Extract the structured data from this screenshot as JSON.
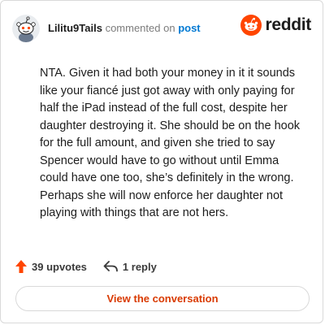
{
  "comment": {
    "username": "Lilitu9Tails",
    "action_text": "commented on",
    "target_link": "post",
    "body": "NTA. Given it had both your money in it it sounds like your fiancé just got away with only paying for half the iPad instead of the full cost, despite her daughter destroying it. She should be on the hook for the full amount, and given she tried to say Spencer would have to go without until Emma could have one too, she’s definitely in the wrong. Perhaps she will now enforce her daughter not playing with things that are not hers."
  },
  "brand": {
    "wordmark": "reddit",
    "accent": "#ff4500"
  },
  "stats": {
    "upvotes": "39 upvotes",
    "replies": "1 reply",
    "upvote_icon": "upvote-arrow-icon",
    "reply_icon": "reply-arrow-icon"
  },
  "cta": {
    "label": "View the conversation"
  },
  "colors": {
    "link": "#0079d3",
    "cta_text": "#d93a00",
    "upvote": "#ff4500",
    "muted": "#7c7c7c"
  }
}
